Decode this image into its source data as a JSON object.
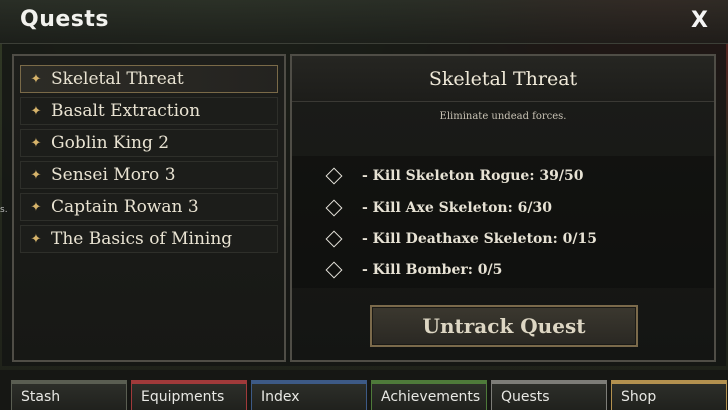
{
  "window": {
    "title": "Quests",
    "close_label": "X"
  },
  "quest_list": [
    {
      "name": "Skeletal Threat",
      "selected": true
    },
    {
      "name": "Basalt Extraction",
      "selected": false
    },
    {
      "name": "Goblin King 2",
      "selected": false
    },
    {
      "name": "Sensei Moro 3",
      "selected": false
    },
    {
      "name": "Captain Rowan 3",
      "selected": false
    },
    {
      "name": "The Basics of Mining",
      "selected": false
    }
  ],
  "detail": {
    "title": "Skeletal Threat",
    "description": "Eliminate undead forces.",
    "objectives": [
      "- Kill Skeleton Rogue: 39/50",
      "- Kill Axe Skeleton: 6/30",
      "- Kill Deathaxe Skeleton: 0/15",
      "- Kill Bomber: 0/5"
    ],
    "untrack_label": "Untrack Quest"
  },
  "tabs": [
    {
      "label": "Stash",
      "color": "#5a5e52"
    },
    {
      "label": "Equipments",
      "color": "#a03a3a"
    },
    {
      "label": "Index",
      "color": "#3d5a86"
    },
    {
      "label": "Achievements",
      "color": "#4e7a3a"
    },
    {
      "label": "Quests",
      "color": "#7d7d78"
    },
    {
      "label": "Shop",
      "color": "#b3914f"
    }
  ],
  "side_fragment": "s."
}
